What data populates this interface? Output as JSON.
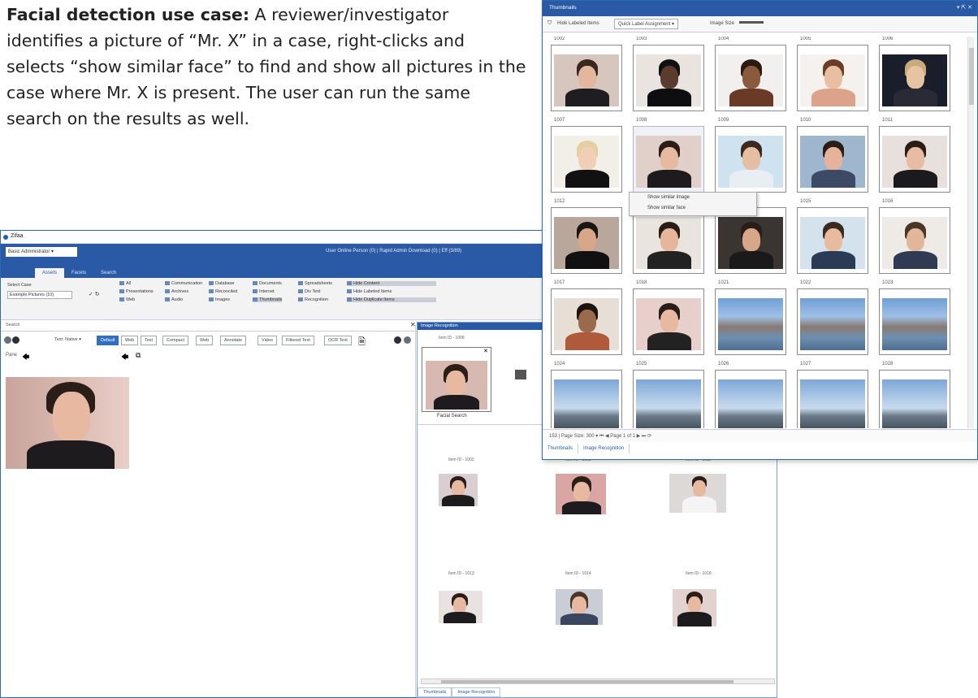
{
  "description": {
    "heading": "Facial detection use case:",
    "body": "A reviewer/investigator identifies a picture of “Mr. X” in a case, right-clicks and selects “show similar face” to find and show all pictures in the case where Mr. X is present. The user can run the same search on the results as well."
  },
  "back_window": {
    "title": "Zifaa",
    "workspace": "Basic Administrator ▾",
    "status": "User Online Person (0) | Rapid Admin Download (0) | Eff (3/89)",
    "ribbon_tabs": [
      "Assets",
      "Facets",
      "Search"
    ],
    "ribbon_items": [
      "All",
      "Presentations",
      "Web",
      "Communication",
      "Archives",
      "Audio",
      "Database",
      "Reconciled",
      "Images",
      "Documents",
      "Internet",
      "Thumbnails",
      "Spreadsheets",
      "Div Text",
      "Recognition",
      "Hide Content",
      "Hide Labeled Items",
      "Hide Duplicate Items"
    ],
    "case_label": "Select Case",
    "case_value": "Example Pictures (10)",
    "search_placeholder": "Search",
    "view_buttons": [
      "Default",
      "Web",
      "Text",
      "Compact",
      "Web",
      "Annotate",
      "Video",
      "Filtered Text",
      "OCR Text"
    ],
    "text_label": "Text: Native ▾",
    "pane_label": "Pane"
  },
  "image_recognition": {
    "title": "Image Recognition",
    "source_label": "Item ID - 1008",
    "facial_search_label": "Facial Search",
    "results": [
      {
        "label": "Item ID - 1002"
      },
      {
        "label": "Item ID - 1008"
      },
      {
        "label": "Item ID - 1011"
      },
      {
        "label": "Item ID - 1013"
      },
      {
        "label": "Item ID - 1014"
      },
      {
        "label": "Item ID - 1018"
      }
    ],
    "tabs": [
      "Thumbnails",
      "Image Recognition"
    ]
  },
  "thumbnails_window": {
    "title": "Thumbnails",
    "hide_labeled": "Hide Labeled Items",
    "quick_label": "Quick Label Assignment ▾",
    "image_size": "Image Size",
    "items": [
      "1002",
      "1003",
      "1004",
      "1005",
      "1006",
      "1007",
      "1008",
      "1009",
      "1010",
      "1011",
      "1012",
      "1013",
      "1014",
      "1015",
      "1016",
      "1017",
      "1018",
      "1021",
      "1022",
      "1023",
      "1024",
      "1025",
      "1026",
      "1027",
      "1028"
    ],
    "context_menu": [
      "Show similar image",
      "Show similar face"
    ],
    "pager": "153 | Page Size: 300   ▾  ⏮  ◀  Page  1     of 1  ▶  ⏭  ⟳",
    "tabs": [
      "Thumbnails",
      "Image Recognition"
    ]
  }
}
